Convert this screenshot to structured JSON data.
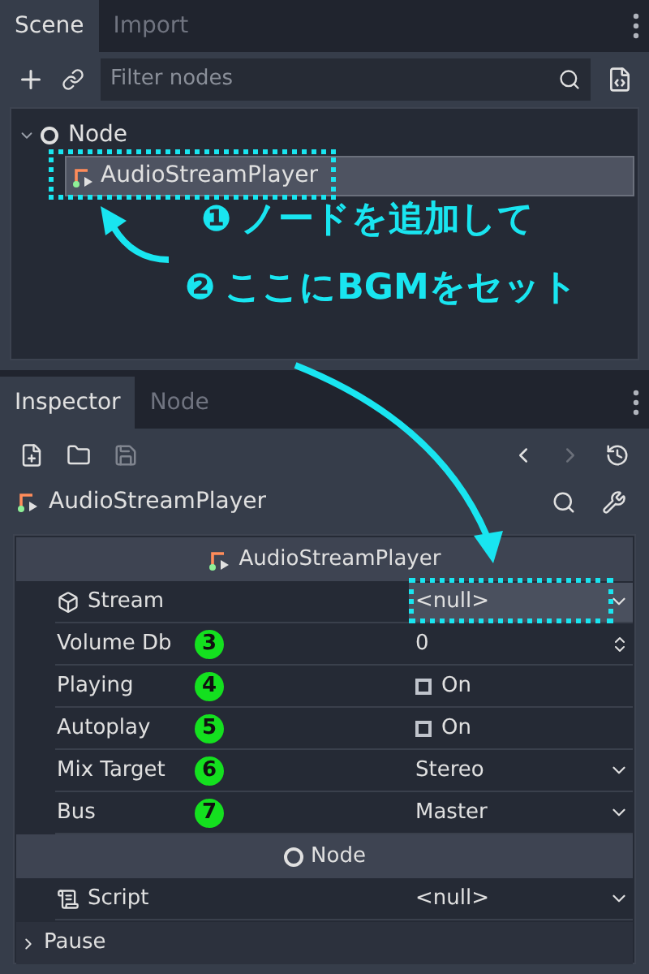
{
  "scene_dock": {
    "tabs": [
      {
        "label": "Scene",
        "selected": true
      },
      {
        "label": "Import",
        "selected": false
      }
    ],
    "filter": {
      "placeholder": "Filter nodes"
    },
    "tree": [
      {
        "label": "Node",
        "expanded": true,
        "children": [
          {
            "label": "AudioStreamPlayer",
            "selected": true,
            "highlighted": true
          }
        ]
      }
    ]
  },
  "callouts": [
    {
      "number": "❶",
      "text": "ノードを追加して"
    },
    {
      "number": "❷",
      "text": "ここにBGMをセット"
    }
  ],
  "inspector": {
    "tabs": [
      {
        "label": "Inspector",
        "selected": true
      },
      {
        "label": "Node",
        "selected": false
      }
    ],
    "object": "AudioStreamPlayer",
    "sections": [
      {
        "title": "AudioStreamPlayer",
        "expanded": true,
        "properties": [
          {
            "label": "Stream",
            "kind": "resource",
            "value": "<null>",
            "highlighted": true
          },
          {
            "label": "Volume Db",
            "kind": "number",
            "value": "0",
            "marker": "3"
          },
          {
            "label": "Playing",
            "kind": "checkbox",
            "value": "On",
            "checked": false,
            "marker": "4"
          },
          {
            "label": "Autoplay",
            "kind": "checkbox",
            "value": "On",
            "checked": false,
            "marker": "5"
          },
          {
            "label": "Mix Target",
            "kind": "enum",
            "value": "Stereo",
            "marker": "6"
          },
          {
            "label": "Bus",
            "kind": "enum",
            "value": "Master",
            "marker": "7"
          }
        ]
      },
      {
        "title": "Node",
        "expanded": true,
        "properties": [
          {
            "label": "Script",
            "kind": "script",
            "value": "<null>"
          }
        ]
      },
      {
        "title": "Pause",
        "expanded": false
      }
    ]
  }
}
